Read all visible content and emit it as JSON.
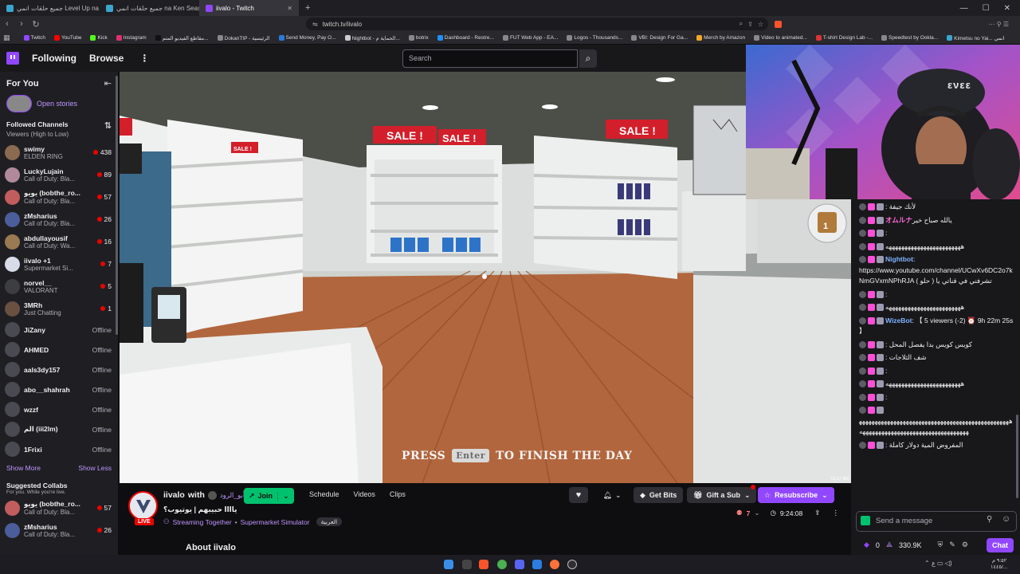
{
  "browser": {
    "tabs": [
      {
        "label": "جميع حلقات انمي Level Up na Ken",
        "active": false
      },
      {
        "label": "جميع حلقات انمي na Ken Season 2",
        "active": false
      },
      {
        "label": "iivalo - Twitch",
        "active": true
      }
    ],
    "new_tab": "+",
    "url": "twitch.tv/iivalo",
    "bookmarks": [
      "Twitch",
      "YouTube",
      "Kick",
      "Instagram",
      "مقاطع الفيديو المتم...",
      "DokanTIP - الرئيسية",
      "Send Money, Pay O...",
      "Nightbot - الحماية م...",
      "botrix",
      "Dashboard - Restre...",
      "FUT Web App - EA...",
      "Logos - Thousands...",
      "VBI: Design For Ga...",
      "Merch by Amazon",
      "Video to animated...",
      "T-shirt Design Lab -...",
      "Speedtest by Ookla...",
      "Kimetsu no Yai... انمي"
    ]
  },
  "topnav": {
    "following": "Following",
    "browse": "Browse",
    "more": "⋮",
    "search_placeholder": "Search"
  },
  "sidebar": {
    "for_you": "For You",
    "collapse": "⇤",
    "open_stories": "Open stories",
    "followed_title": "Followed Channels",
    "followed_sub": "Viewers (High to Low)",
    "sort_icon": "⇅",
    "live_channels": [
      {
        "name": "swimy",
        "game": "ELDEN RING",
        "viewers": "438",
        "color": "#8a6a50"
      },
      {
        "name": "LuckyLujain",
        "game": "Call of Duty: Bla...",
        "viewers": "89",
        "color": "#b08a9a"
      },
      {
        "name": "يويو (bobthe_ro...",
        "game": "Call of Duty: Bla...",
        "viewers": "57",
        "color": "#c25d5d"
      },
      {
        "name": "zMsharius",
        "game": "Call of Duty: Bla...",
        "viewers": "26",
        "color": "#4b5d9a"
      },
      {
        "name": "abdullayousif",
        "game": "Call of Duty: Wa...",
        "viewers": "16",
        "color": "#9a7a52"
      },
      {
        "name": "iivalo +1",
        "game": "Supermarket Si...",
        "viewers": "7",
        "color": "#d8dbe8"
      },
      {
        "name": "norvel__",
        "game": "VALORANT",
        "viewers": "5",
        "color": "#3d3d44"
      },
      {
        "name": "3MRh",
        "game": "Just Chatting",
        "viewers": "1",
        "color": "#6a5040"
      }
    ],
    "offline_channels": [
      {
        "name": "JiZany",
        "status": "Offline"
      },
      {
        "name": "AHMED",
        "status": "Offline"
      },
      {
        "name": "aals3dy157",
        "status": "Offline"
      },
      {
        "name": "abo__shahrah",
        "status": "Offline"
      },
      {
        "name": "wzzf",
        "status": "Offline"
      },
      {
        "name": "الم (iii2lm)",
        "status": "Offline"
      },
      {
        "name": "1Frixi",
        "status": "Offline"
      }
    ],
    "show_more": "Show More",
    "show_less": "Show Less",
    "suggested_title": "Suggested Collabs",
    "suggested_sub": "For you. While you're live.",
    "suggested": [
      {
        "name": "يويو (bobthe_ro...",
        "game": "Call of Duty: Bla...",
        "viewers": "57",
        "color": "#c25d5d"
      },
      {
        "name": "zMsharius",
        "game": "Call of Duty: Bla...",
        "viewers": "26",
        "color": "#4b5d9a"
      }
    ]
  },
  "video": {
    "sale_signs": [
      "SALE !",
      "SALE !",
      "SALE !",
      "SALE !"
    ],
    "hint_press": "PRESS",
    "hint_key": "Enter",
    "hint_rest": "TO FINISH THE DAY",
    "box_count": "1",
    "version": "V1.17 (82)",
    "webcam_cap_logo": "ενεε"
  },
  "stream_info": {
    "channel": "iivalo",
    "with": "with",
    "collab": "أبو_الرود",
    "live_badge": "LIVE",
    "join": "Join",
    "tabs": [
      "Schedule",
      "Videos",
      "Clips"
    ],
    "title": "ياااا حبيبهم | يوتيوب؟",
    "streaming_together": "Streaming Together",
    "game": "Supermarket Simulator",
    "language_tag": "العربية",
    "viewers": "7",
    "uptime": "9:24:08",
    "get_bits": "Get Bits",
    "gift_sub": "Gift a Sub",
    "resubscribe": "Resubscribe",
    "about": "About iivalo"
  },
  "chat": {
    "messages": [
      {
        "user": "",
        "user_color": "#8a7dff",
        "text": ": لأنك جيفة"
      },
      {
        "user": "オムルナ",
        "user_color": "#ff6ad5",
        "text": "يالله صباح خير"
      },
      {
        "user": "",
        "user_color": "#8a7dff",
        "text": ":"
      },
      {
        "user": "",
        "user_color": "#8a7dff",
        "text": "ههههههههههههههههههههههههه"
      },
      {
        "user": "Nightbot",
        "user_color": "#7fb2ff",
        "text": ": https://www.youtube.com/channel/UCwXv6DC2o7kNmGVxmNPhRJA تشرفني في قناتي يا ( حلو )",
        "link": "https://www.youtube.com/channel/UCwXv6DC2o7kNmGVxmNPhRJA"
      },
      {
        "user": "",
        "user_color": "#8a7dff",
        "text": ":"
      },
      {
        "user": "",
        "user_color": "#8a7dff",
        "text": "ههههههههههههههههههههههههه"
      },
      {
        "user": "WizeBot",
        "user_color": "#7fb2ff",
        "text": ": 【 5 viewers (-2) ⏰ 9h 22m 25s 】"
      },
      {
        "user": "",
        "user_color": "#8a7dff",
        "text": ": كويس كويس بدا يفصل المحل"
      },
      {
        "user": "",
        "user_color": "#8a7dff",
        "text": ": شف الثلاجات"
      },
      {
        "user": "",
        "user_color": "#8a7dff",
        "text": ":"
      },
      {
        "user": "",
        "user_color": "#8a7dff",
        "text": "ههههههههههههههههههههههههه"
      },
      {
        "user": "",
        "user_color": "#8a7dff",
        "text": ":"
      },
      {
        "user": "",
        "user_color": "#8a7dff",
        "text": "هههههههههههههههههههههههههههههههههههههههههههههههههههههههههههههههههههههههههههههههههههه"
      },
      {
        "user": "",
        "user_color": "#8a7dff",
        "text": ": المفروض المية دولار كاملة"
      }
    ],
    "input_placeholder": "Send a message",
    "bits": "0",
    "points": "330.9K",
    "chat_button": "Chat"
  },
  "taskbar": {
    "time": "٩:٥٢ م",
    "date": "١٤٤٥/..."
  }
}
